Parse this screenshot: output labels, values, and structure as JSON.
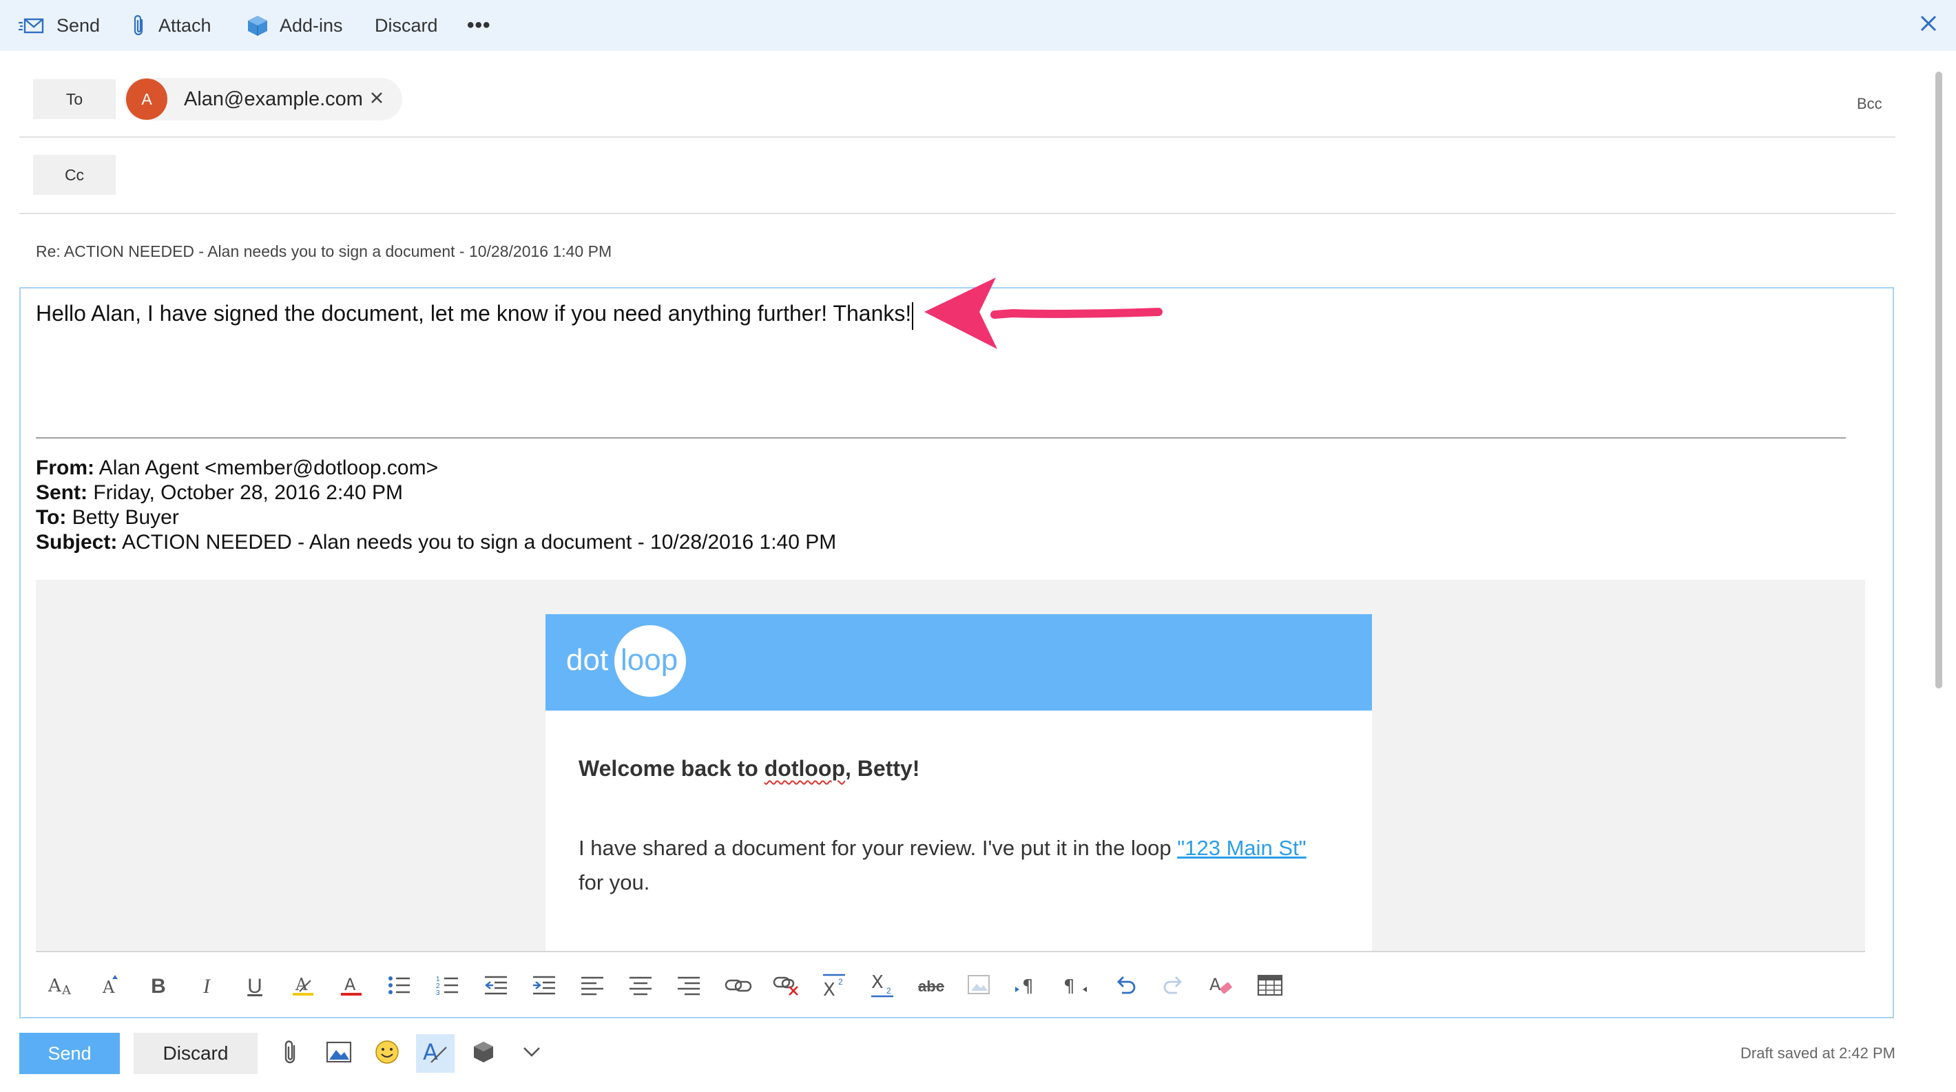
{
  "toolbar": {
    "send_label": "Send",
    "attach_label": "Attach",
    "addins_label": "Add-ins",
    "discard_label": "Discard",
    "more_label": "•••"
  },
  "recipients": {
    "to_label": "To",
    "cc_label": "Cc",
    "bcc_label": "Bcc",
    "to_chip": {
      "initial": "A",
      "email": "Alan@example.com",
      "avatar_color": "#d9542b"
    }
  },
  "subject": "Re: ACTION NEEDED - Alan needs you to sign a document - 10/28/2016 1:40 PM",
  "body": {
    "typed_text": "Hello Alan, I have signed the document, let me know if you need anything further! Thanks!",
    "quoted_header": {
      "from_label": "From:",
      "from_value": " Alan Agent <member@dotloop.com>",
      "sent_label": "Sent:",
      "sent_value": " Friday, October 28, 2016 2:40 PM",
      "to_label": "To:",
      "to_value": " Betty Buyer",
      "subject_label": "Subject:",
      "subject_value": " ACTION NEEDED - Alan needs you to sign a document - 10/28/2016 1:40 PM"
    },
    "email_card": {
      "logo_left": "dot",
      "logo_right": "loop",
      "welcome_prefix": "Welcome back to ",
      "welcome_brand": "dotloop",
      "welcome_suffix": ", Betty!",
      "para_line1_prefix": "I have shared a document for your review. I've put it in the loop ",
      "para_link": "\"123 Main St\"",
      "para_line2": "for you.",
      "header_color": "#66b5f9"
    }
  },
  "format_toolbar": {
    "icons": [
      "font-size-icon",
      "grow-font-icon",
      "bold-icon",
      "italic-icon",
      "underline-icon",
      "highlight-icon",
      "font-color-icon",
      "bullets-icon",
      "numbering-icon",
      "decrease-indent-icon",
      "increase-indent-icon",
      "align-left-icon",
      "align-center-icon",
      "align-right-icon",
      "insert-link-icon",
      "remove-link-icon",
      "superscript-icon",
      "subscript-icon",
      "strikethrough-icon",
      "insert-image-inline-icon",
      "ltr-icon",
      "rtl-icon",
      "undo-icon",
      "redo-icon",
      "clear-formatting-icon",
      "insert-table-icon"
    ],
    "bold": "B",
    "italic": "I",
    "underline": "U",
    "strike": "abc"
  },
  "bottom_bar": {
    "send_label": "Send",
    "discard_label": "Discard",
    "draft_status": "Draft saved at 2:42 PM"
  },
  "colors": {
    "accent": "#5aaef5",
    "command_bar_bg": "#eaf3fc",
    "annotation_arrow": "#f0326e"
  }
}
